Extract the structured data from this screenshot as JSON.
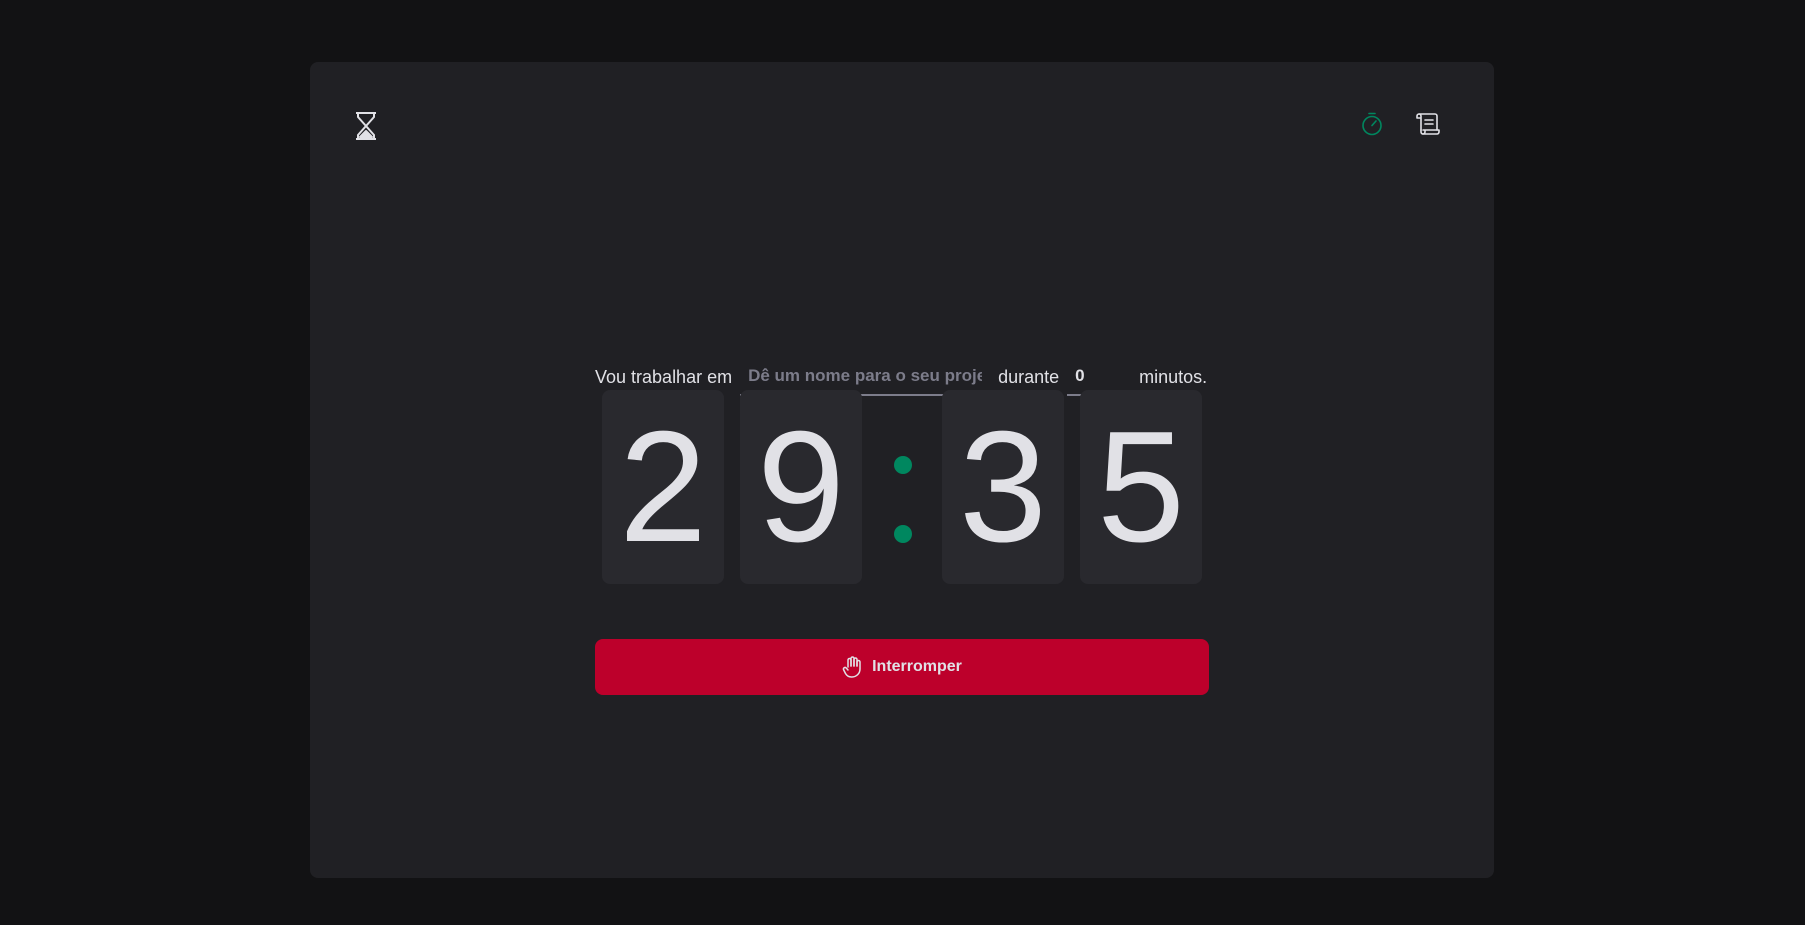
{
  "header": {
    "logo_icon": "hourglass-icon",
    "nav": [
      {
        "icon": "timer-icon",
        "color": "#00875f"
      },
      {
        "icon": "scroll-history-icon",
        "color": "#e1e1e6"
      }
    ]
  },
  "form": {
    "task_label": "Vou trabalhar em",
    "task_placeholder": "Dê um nome para o seu projeto",
    "duration_label": "durante",
    "minutes_value": "0",
    "minutes_suffix": "minutos."
  },
  "countdown": {
    "minutes_tens": "2",
    "minutes_ones": "9",
    "seconds_tens": "3",
    "seconds_ones": "5"
  },
  "actions": {
    "stop_label": "Interromper",
    "stop_icon": "hand-palm-icon"
  },
  "colors": {
    "background": "#121214",
    "card": "#202024",
    "digit_bg": "#29292e",
    "accent": "#00875f",
    "danger": "#bd002b",
    "text": "#e1e1e6",
    "placeholder": "#7c7c8a"
  }
}
